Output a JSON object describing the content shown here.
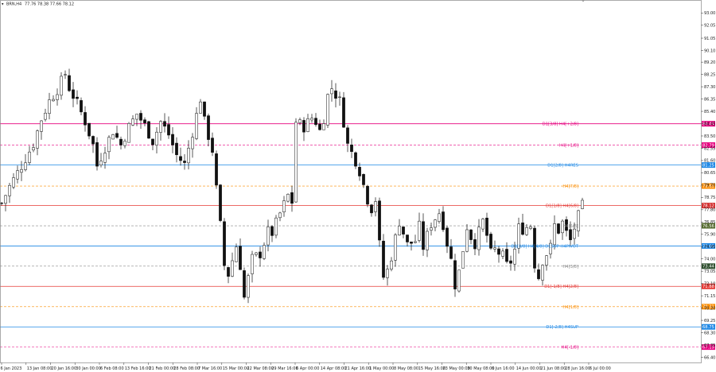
{
  "header": {
    "symbol_menu": "▾",
    "symbol": "BRN,H4",
    "ohlc": "77.76 78.38 77.66 78.12"
  },
  "chart_data": {
    "type": "candlestick",
    "symbol": "BRN,H4",
    "ylim": [
      66.0,
      94.0
    ],
    "y_ticks": [
      "93.00",
      "92.05",
      "91.05",
      "90.10",
      "89.20",
      "88.25",
      "87.30",
      "86.35",
      "85.40",
      "84.45",
      "83.50",
      "82.55",
      "81.60",
      "80.65",
      "79.70",
      "78.75",
      "77.80",
      "76.85",
      "75.90",
      "74.95",
      "74.00",
      "73.05",
      "72.10",
      "71.15",
      "70.20",
      "69.25",
      "68.30",
      "67.35",
      "66.40"
    ],
    "x_ticks": [
      "6 Jan 2023",
      "13 Jan 08:00",
      "20 Jan 16:00",
      "30 Jan 00:00",
      "6 Feb 08:00",
      "13 Feb 16:00",
      "21 Feb 00:00",
      "28 Feb 08:00",
      "7 Mar 16:00",
      "15 Mar 00:00",
      "22 Mar 08:00",
      "29 Mar 16:00",
      "6 Apr 00:00",
      "14 Apr 08:00",
      "21 Apr 16:00",
      "1 May 00:00",
      "8 May 08:00",
      "15 May 16:00",
      "23 May 00:00",
      "30 May 08:00",
      "6 Jun 16:00",
      "14 Jun 00:00",
      "21 Jun 08:00",
      "28 Jun 16:00",
      "6 Jul 00:00"
    ],
    "close_path": [
      [
        0,
        78.3
      ],
      [
        2,
        79.6
      ],
      [
        5,
        81.2
      ],
      [
        8,
        82.9
      ],
      [
        10,
        84.8
      ],
      [
        12,
        86.2
      ],
      [
        14,
        87.1
      ],
      [
        16,
        88.3
      ],
      [
        17,
        87.2
      ],
      [
        19,
        86.0
      ],
      [
        21,
        84.6
      ],
      [
        23,
        82.8
      ],
      [
        24,
        81.2
      ],
      [
        26,
        82.6
      ],
      [
        28,
        83.9
      ],
      [
        30,
        82.8
      ],
      [
        32,
        84.2
      ],
      [
        34,
        85.2
      ],
      [
        36,
        84.3
      ],
      [
        38,
        83.1
      ],
      [
        40,
        84.6
      ],
      [
        42,
        83.6
      ],
      [
        44,
        82.0
      ],
      [
        46,
        81.3
      ],
      [
        48,
        83.8
      ],
      [
        50,
        86.4
      ],
      [
        51,
        84.6
      ],
      [
        53,
        82.4
      ],
      [
        54,
        79.4
      ],
      [
        55,
        76.6
      ],
      [
        56,
        73.5
      ],
      [
        57,
        72.8
      ],
      [
        59,
        75.0
      ],
      [
        60,
        73.5
      ],
      [
        61,
        71.0
      ],
      [
        62,
        72.5
      ],
      [
        63,
        74.0
      ],
      [
        65,
        74.4
      ],
      [
        67,
        76.1
      ],
      [
        68,
        76.0
      ],
      [
        70,
        77.5
      ],
      [
        72,
        78.9
      ],
      [
        73,
        78.4
      ],
      [
        74,
        84.6
      ],
      [
        76,
        84.2
      ],
      [
        78,
        84.9
      ],
      [
        79,
        84.6
      ],
      [
        80,
        83.9
      ],
      [
        81,
        84.9
      ],
      [
        82,
        86.6
      ],
      [
        83,
        87.2
      ],
      [
        85,
        86.2
      ],
      [
        86,
        84.6
      ],
      [
        87,
        82.8
      ],
      [
        89,
        81.6
      ],
      [
        90,
        80.8
      ],
      [
        91,
        79.7
      ],
      [
        92,
        78.6
      ],
      [
        93,
        77.9
      ],
      [
        94,
        78.6
      ],
      [
        95,
        75.1
      ],
      [
        96,
        72.6
      ],
      [
        97,
        73.1
      ],
      [
        98,
        74.2
      ],
      [
        99,
        75.6
      ],
      [
        100,
        76.9
      ],
      [
        102,
        75.1
      ],
      [
        104,
        75.4
      ],
      [
        105,
        76.5
      ],
      [
        106,
        74.9
      ],
      [
        107,
        75.8
      ],
      [
        108,
        76.7
      ],
      [
        110,
        77.6
      ],
      [
        111,
        76.7
      ],
      [
        112,
        75.2
      ],
      [
        113,
        73.9
      ],
      [
        114,
        72.0
      ],
      [
        115,
        73.0
      ],
      [
        117,
        76.5
      ],
      [
        118,
        75.7
      ],
      [
        119,
        75.2
      ],
      [
        121,
        76.9
      ],
      [
        122,
        75.8
      ],
      [
        123,
        74.4
      ],
      [
        124,
        74.7
      ],
      [
        126,
        74.2
      ],
      [
        127,
        73.5
      ],
      [
        128,
        73.8
      ],
      [
        129,
        74.7
      ],
      [
        130,
        76.4
      ],
      [
        131,
        76.3
      ],
      [
        133,
        76.6
      ],
      [
        134,
        73.6
      ],
      [
        135,
        72.6
      ],
      [
        136,
        73.9
      ],
      [
        138,
        74.9
      ],
      [
        139,
        76.6
      ],
      [
        140,
        76.2
      ],
      [
        141,
        76.8
      ],
      [
        142,
        76.0
      ],
      [
        143,
        75.4
      ],
      [
        144,
        76.4
      ],
      [
        145,
        77.3
      ],
      [
        146,
        78.1
      ]
    ],
    "levels": [
      {
        "label": "D1[3/8] H4[+2/8]",
        "value": 84.44,
        "tag": "84.44",
        "color": "#e6007e",
        "tagcolor": "#e6007e",
        "dash": false
      },
      {
        "label": "H4[+1/8]",
        "value": 82.79,
        "tag": "82.79",
        "color": "#e6007e",
        "tagcolor": "#e6007e",
        "dash": true
      },
      {
        "label": "D1[2/8] H4RES",
        "value": 81.25,
        "tag": "81.25",
        "color": "#1e88e5",
        "tagcolor": "#1e88e5",
        "dash": false
      },
      {
        "label": "H4[7/8]",
        "value": 79.63,
        "tag": "79.63",
        "color": "#fb8c00",
        "tagcolor": "#fb8c00",
        "dash": true
      },
      {
        "label": "D1[1/8] H4[6/8]",
        "value": 78.12,
        "tag": "78.12",
        "color": "#e53935",
        "tagcolor": "#d32f2f",
        "dash": false
      },
      {
        "label": "H4[5/8]",
        "value": 76.56,
        "tag": "76.56",
        "color": "#888888",
        "tagcolor": "#556b2f",
        "dash": true
      },
      {
        "label": "D1[0/8] H4[4/8] D1SUP H4PIVOT",
        "value": 75.0,
        "tag": "75.00",
        "color": "#1e88e5",
        "tagcolor": "#1e88e5",
        "dash": false
      },
      {
        "label": "H4[3/8]",
        "value": 73.44,
        "tag": "73.44",
        "color": "#888888",
        "tagcolor": "#2f4f2f",
        "dash": true
      },
      {
        "label": "D1[-1/8] H4[2/8]",
        "value": 71.88,
        "tag": "71.88",
        "color": "#e53935",
        "tagcolor": "#e53935",
        "dash": false
      },
      {
        "label": "H4[1/8]",
        "value": 70.31,
        "tag": "70.31",
        "color": "#fb8c00",
        "tagcolor": "#fb8c00",
        "dash": true
      },
      {
        "label": "D1[-2/8] H4SUP",
        "value": 68.75,
        "tag": "68.75",
        "color": "#1e88e5",
        "tagcolor": "#1e88e5",
        "dash": false
      },
      {
        "label": "H4[-1/8]",
        "value": 67.19,
        "tag": "67.19",
        "color": "#e6007e",
        "tagcolor": "#e6007e",
        "dash": true
      }
    ]
  }
}
